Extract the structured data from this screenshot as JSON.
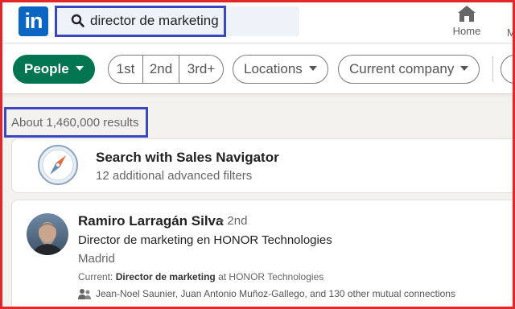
{
  "nav": {
    "logo_text": "in",
    "search": {
      "value": "director de marketing"
    },
    "home_label": "Home",
    "next_label_partial": "M"
  },
  "filters": {
    "people": "People",
    "degrees": [
      "1st",
      "2nd",
      "3rd+"
    ],
    "locations": "Locations",
    "current_company": "Current company"
  },
  "results": {
    "count_text": "About 1,460,000 results"
  },
  "sales_navigator": {
    "title": "Search with Sales Navigator",
    "subtitle": "12 additional advanced filters"
  },
  "person": {
    "name": "Ramiro Larragán Silva",
    "degree": "• 2nd",
    "headline": "Director de marketing en HONOR Technologies",
    "location": "Madrid",
    "current_prefix": "Current: ",
    "current_role": "Director de marketing",
    "current_suffix": " at HONOR Technologies",
    "mutual_connections": "Jean-Noel Saunier, Juan Antonio Muñoz-Gallego, and 130 other mutual connections"
  },
  "colors": {
    "brand": "#0a66c2",
    "people_pill": "#01754f",
    "highlight_box": "#3a47c0",
    "frame": "#e3262a"
  }
}
